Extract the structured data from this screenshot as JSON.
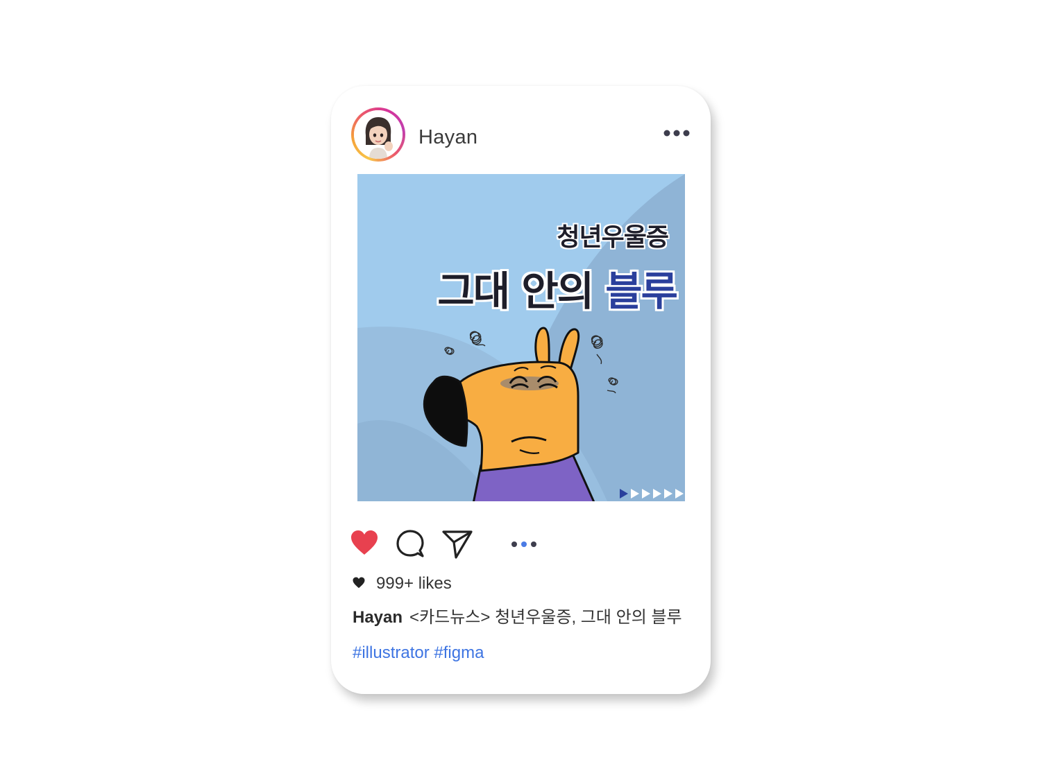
{
  "post": {
    "username": "Hayan",
    "image": {
      "subtitle": "청년우울증",
      "title_dark": "그대 안의",
      "title_blue": "블루",
      "colors": {
        "background": "#a4cdee",
        "title_blue": "#2a3f9c",
        "character": "#f8ad42",
        "shirt": "#7e63c5"
      }
    },
    "actions": {
      "like_icon": "heart-icon",
      "comment_icon": "comment-icon",
      "share_icon": "send-icon",
      "carousel_icon": "carousel-dots-icon",
      "more_icon": "more-horizontal-icon"
    },
    "likes": "999+ likes",
    "caption_user": "Hayan",
    "caption_text": "<카드뉴스> 청년우울증, 그대 안의 블루",
    "hashtags": "#illustrator #figma",
    "accent_colors": {
      "heart": "#e8414f",
      "hashtag": "#3d74e2",
      "active_dot": "#4a7be5"
    }
  }
}
